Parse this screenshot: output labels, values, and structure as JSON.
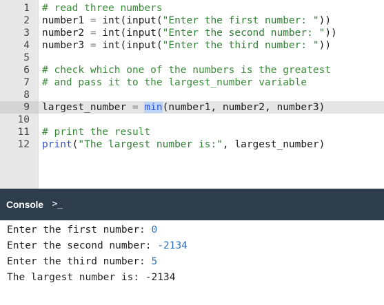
{
  "editor": {
    "lines": [
      {
        "num": "1",
        "tokens": [
          {
            "t": "# read three numbers",
            "c": "comment"
          }
        ]
      },
      {
        "num": "2",
        "tokens": [
          {
            "t": "number1 ",
            "c": "plain"
          },
          {
            "t": "=",
            "c": "op"
          },
          {
            "t": " int",
            "c": "plain"
          },
          {
            "t": "(input(",
            "c": "plain"
          },
          {
            "t": "\"Enter the first number: \"",
            "c": "string"
          },
          {
            "t": "))",
            "c": "plain"
          }
        ]
      },
      {
        "num": "3",
        "tokens": [
          {
            "t": "number2 ",
            "c": "plain"
          },
          {
            "t": "=",
            "c": "op"
          },
          {
            "t": " int",
            "c": "plain"
          },
          {
            "t": "(input(",
            "c": "plain"
          },
          {
            "t": "\"Enter the second number: \"",
            "c": "string"
          },
          {
            "t": "))",
            "c": "plain"
          }
        ]
      },
      {
        "num": "4",
        "tokens": [
          {
            "t": "number3 ",
            "c": "plain"
          },
          {
            "t": "=",
            "c": "op"
          },
          {
            "t": " int",
            "c": "plain"
          },
          {
            "t": "(input(",
            "c": "plain"
          },
          {
            "t": "\"Enter the third number: \"",
            "c": "string"
          },
          {
            "t": "))",
            "c": "plain"
          }
        ]
      },
      {
        "num": "5",
        "tokens": []
      },
      {
        "num": "6",
        "tokens": [
          {
            "t": "# check which one of the numbers is the greatest",
            "c": "comment"
          }
        ]
      },
      {
        "num": "7",
        "tokens": [
          {
            "t": "# and pass it to the largest_number variable",
            "c": "comment"
          }
        ]
      },
      {
        "num": "8",
        "tokens": []
      },
      {
        "num": "9",
        "active": true,
        "tokens": [
          {
            "t": "largest_number ",
            "c": "plain"
          },
          {
            "t": "=",
            "c": "op"
          },
          {
            "t": " ",
            "c": "plain"
          },
          {
            "t": "min",
            "c": "builtin-sel"
          },
          {
            "t": "(number1, number2, number3)",
            "c": "plain"
          }
        ]
      },
      {
        "num": "10",
        "tokens": []
      },
      {
        "num": "11",
        "tokens": [
          {
            "t": "# print the result",
            "c": "comment"
          }
        ]
      },
      {
        "num": "12",
        "tokens": [
          {
            "t": "print",
            "c": "builtin"
          },
          {
            "t": "(",
            "c": "plain"
          },
          {
            "t": "\"The largest number is:\"",
            "c": "string"
          },
          {
            "t": ", largest_number)",
            "c": "plain"
          }
        ]
      }
    ]
  },
  "console": {
    "title": "Console",
    "prompt_icon": "terminal-prompt-icon",
    "prompt_glyph": ">_",
    "output": [
      {
        "prompt": "Enter the first number: ",
        "input": "0"
      },
      {
        "prompt": "Enter the second number: ",
        "input": "-2134"
      },
      {
        "prompt": "Enter the third number: ",
        "input": "5"
      },
      {
        "prompt": "The largest number is: -2134",
        "input": ""
      }
    ]
  },
  "colors": {
    "console_header_bg": "#2e3d4b",
    "comment": "#3a8c3a",
    "string": "#2e7d32",
    "builtin": "#3355cc",
    "console_input": "#2a6fbb",
    "selection": "#bcd4f6"
  }
}
